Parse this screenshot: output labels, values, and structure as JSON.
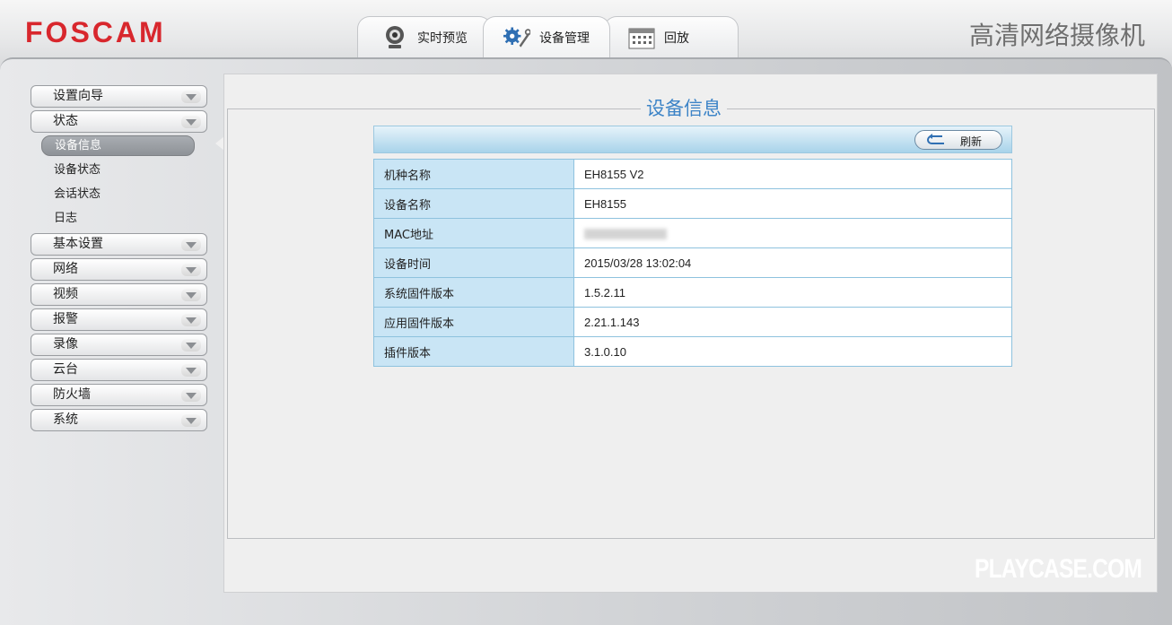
{
  "header": {
    "logo": "FOSCAM",
    "title": "高清网络摄像机",
    "tabs": [
      {
        "label": "实时预览",
        "icon": "webcam-icon"
      },
      {
        "label": "设备管理",
        "icon": "gears-icon"
      },
      {
        "label": "回放",
        "icon": "calendar-icon"
      }
    ]
  },
  "sidebar": {
    "items": [
      {
        "label": "设置向导"
      },
      {
        "label": "状态"
      },
      {
        "label": "基本设置"
      },
      {
        "label": "网络"
      },
      {
        "label": "视频"
      },
      {
        "label": "报警"
      },
      {
        "label": "录像"
      },
      {
        "label": "云台"
      },
      {
        "label": "防火墙"
      },
      {
        "label": "系统"
      }
    ],
    "status_sub": [
      {
        "label": "设备信息"
      },
      {
        "label": "设备状态"
      },
      {
        "label": "会话状态"
      },
      {
        "label": "日志"
      }
    ]
  },
  "main": {
    "section_title": "设备信息",
    "refresh_label": "刷新",
    "rows": [
      {
        "key": "机种名称",
        "value": "EH8155 V2"
      },
      {
        "key": "设备名称",
        "value": "EH8155"
      },
      {
        "key": "MAC地址",
        "value": ""
      },
      {
        "key": "设备时间",
        "value": "2015/03/28 13:02:04"
      },
      {
        "key": "系统固件版本",
        "value": "1.5.2.11"
      },
      {
        "key": "应用固件版本",
        "value": "2.21.1.143"
      },
      {
        "key": "插件版本",
        "value": "3.1.0.10"
      }
    ]
  },
  "watermark": "PLAYCASE.COM",
  "colors": {
    "logo_red": "#d8272d",
    "section_title_blue": "#3d84c7",
    "table_key_bg": "#c9e5f5",
    "table_border": "#8ec2de"
  }
}
